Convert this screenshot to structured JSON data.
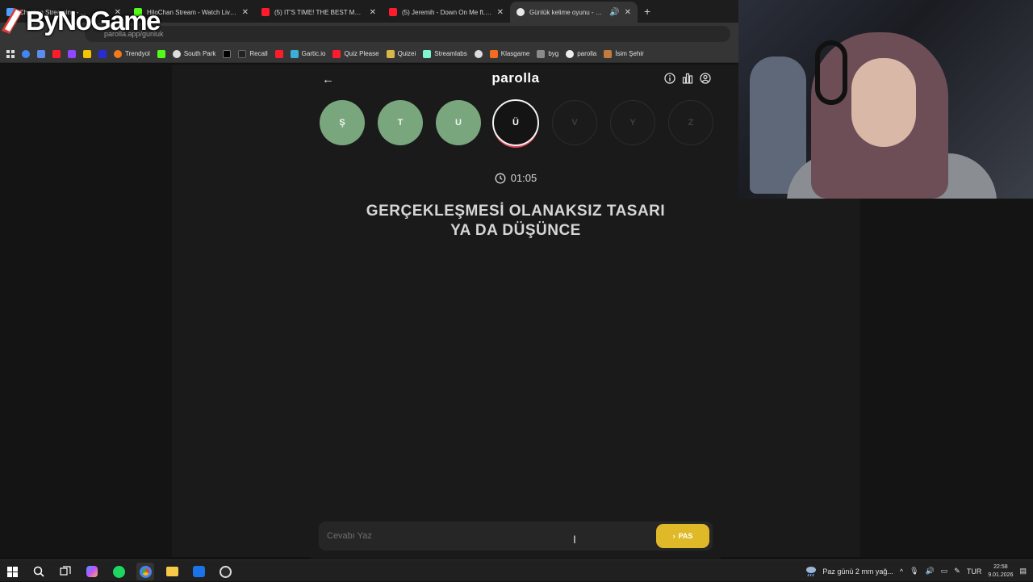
{
  "browser": {
    "tabs": [
      {
        "title": "Chatting Streaming - ...",
        "color": "#4aa3ff"
      },
      {
        "title": "HiloChan Stream - Watch Live c",
        "color": "#53fc18"
      },
      {
        "title": "(5) IT'S TIME! THE BEST MAKEU",
        "color": "#ff1b2d"
      },
      {
        "title": "(5) Jeremih - Down On Me ft. 5(",
        "color": "#ff1b2d"
      },
      {
        "title": "Günlük kelime oyunu - paro",
        "color": "#e8e8e8"
      }
    ],
    "url": "parolla.app/gunluk",
    "bookmarks": [
      "Trendyol",
      "South Park",
      "Recall",
      "Gartic.io",
      "Quiz Please",
      "Quizei",
      "Streamlabs",
      "Klasgame",
      "byg",
      "parolla",
      "İsim Şehir"
    ]
  },
  "overlay": {
    "logo_text": "ByNoGame"
  },
  "app": {
    "title": "parolla",
    "letters": [
      {
        "char": "Ş",
        "state": "done"
      },
      {
        "char": "T",
        "state": "done"
      },
      {
        "char": "U",
        "state": "done"
      },
      {
        "char": "Ü",
        "state": "current"
      },
      {
        "char": "V",
        "state": "todo"
      },
      {
        "char": "Y",
        "state": "todo"
      },
      {
        "char": "Z",
        "state": "todo"
      }
    ],
    "timer": "01:05",
    "clue_line1": "GERÇEKLEŞMESİ OLANAKSIZ TASARI",
    "clue_line2": "YA DA DÜŞÜNCE",
    "answer_placeholder": "Cevabı Yaz",
    "pass_label": "PAS",
    "accent": "#e0b928",
    "done_color": "#7aa67e"
  },
  "taskbar": {
    "weather": "Paz günü 2 mm yağ...",
    "lang": "TUR",
    "time": "22:58",
    "date": "9.01.2026"
  }
}
